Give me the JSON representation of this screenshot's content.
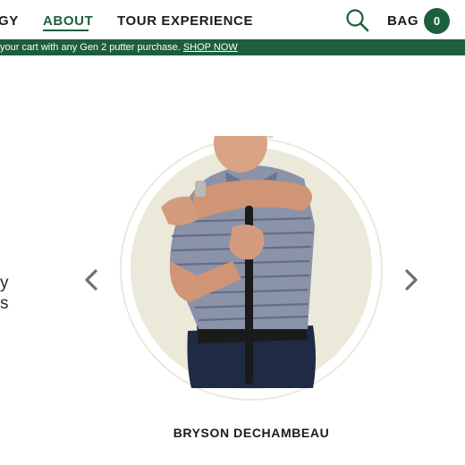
{
  "nav": {
    "items": [
      {
        "label": "GY",
        "active": false
      },
      {
        "label": "ABOUT",
        "active": true
      },
      {
        "label": "TOUR EXPERIENCE",
        "active": false
      }
    ],
    "bag_label": "BAG",
    "bag_count": "0",
    "search_icon": "search-icon"
  },
  "promo": {
    "text": "your cart with any Gen 2 putter purchase. ",
    "link": "SHOP NOW"
  },
  "side_text": {
    "line1": "y",
    "line2": "s"
  },
  "carousel": {
    "prev_icon": "chevron-left-icon",
    "next_icon": "chevron-right-icon",
    "player_name": "BRYSON DECHAMBEAU"
  },
  "colors": {
    "brand_green": "#1d5e3c",
    "circle_bg": "#ebe9d9",
    "arrow_gray": "#6f6f6f"
  }
}
